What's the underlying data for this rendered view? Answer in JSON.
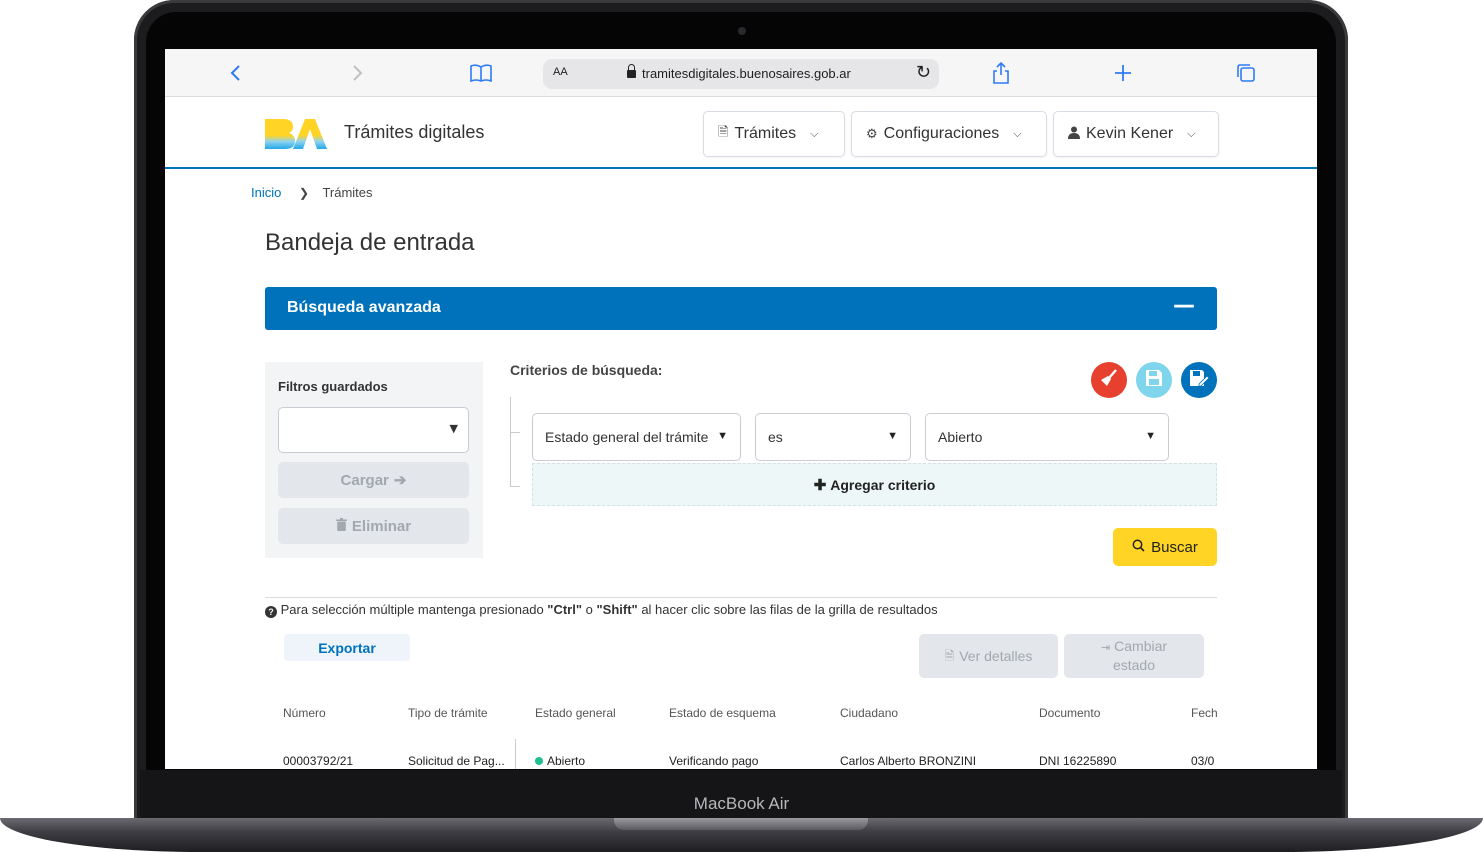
{
  "device": {
    "label": "MacBook Air"
  },
  "browser": {
    "text_size_label": "AA",
    "url": "tramitesdigitales.buenosaires.gob.ar"
  },
  "header": {
    "logo_text": "BA",
    "site_title": "Trámites digitales",
    "nav": [
      {
        "label": "Trámites",
        "icon": "file-icon"
      },
      {
        "label": "Configuraciones",
        "icon": "gear-icon"
      },
      {
        "label": "Kevin Kener",
        "icon": "user-icon"
      }
    ]
  },
  "breadcrumb": {
    "home": "Inicio",
    "current": "Trámites"
  },
  "page": {
    "title": "Bandeja de entrada"
  },
  "advanced_search": {
    "title": "Búsqueda avanzada",
    "toggle": "—",
    "saved_filters": {
      "label": "Filtros guardados",
      "selected": "",
      "load_label": "Cargar",
      "delete_label": "Eliminar"
    },
    "criteria": {
      "label": "Criterios de búsqueda:",
      "field": "Estado general del trámite",
      "operator": "es",
      "value": "Abierto",
      "add_label": "Agregar criterio"
    },
    "search_label": "Buscar",
    "action_colors": {
      "clear": "#e8402f",
      "save": "#7fd6ec",
      "save_as": "#0072bb"
    }
  },
  "hint": {
    "prefix": "Para selección múltiple mantenga presionado ",
    "key1": "\"Ctrl\"",
    "mid": " o ",
    "key2": "\"Shift\"",
    "suffix": " al hacer clic sobre las filas de la grilla de resultados"
  },
  "actions": {
    "export_label": "Exportar",
    "details_label": "Ver detalles",
    "change_state_line1": "Cambiar",
    "change_state_line2": "estado"
  },
  "table": {
    "columns": [
      "Número",
      "Tipo de trámite",
      "Estado general",
      "Estado de esquema",
      "Ciudadano",
      "Documento",
      "Fech"
    ],
    "rows": [
      {
        "numero": "00003792/21",
        "tipo": "Solicitud de Pag...",
        "estado": "Abierto",
        "esquema": "Verificando pago",
        "ciudadano": "Carlos Alberto BRONZINI",
        "documento": "DNI 16225890",
        "fecha": "03/0",
        "status_color": "#1fbf8f"
      }
    ]
  },
  "colors": {
    "brand_blue": "#0072bb",
    "search_yellow": "#ffd424"
  }
}
